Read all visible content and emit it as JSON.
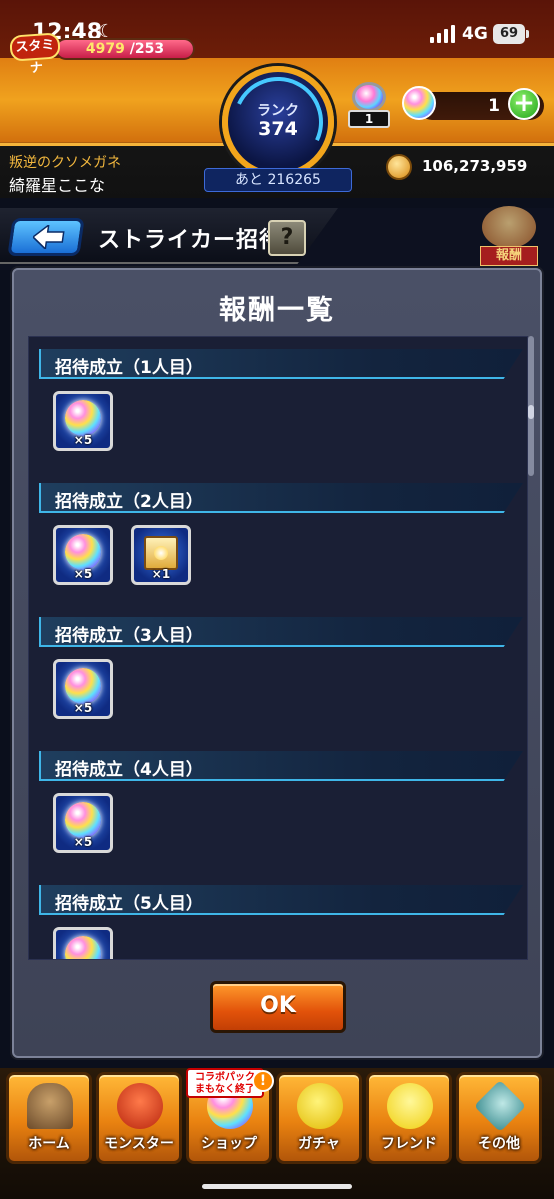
{
  "status_bar": {
    "time": "12:48",
    "network": "4G",
    "battery": "69"
  },
  "hud": {
    "stamina_label": "スタミナ",
    "stamina_current": "4979",
    "stamina_max": "/253",
    "rank_label": "ランク",
    "rank_value": "374",
    "next_rank": "あと 216265",
    "orb_pack_count": "1",
    "orb_count": "1",
    "player_subtitle": "叛逆のクソメガネ",
    "player_name": "綺羅星ここな",
    "coins": "106,273,959"
  },
  "header": {
    "title": "ストライカー招待",
    "help_label": "?",
    "reward_tag": "報酬"
  },
  "modal": {
    "title": "報酬一覧",
    "sections": [
      {
        "label": "招待成立（1人目）",
        "items": [
          {
            "type": "orb",
            "qty": "×5"
          }
        ]
      },
      {
        "label": "招待成立（2人目）",
        "items": [
          {
            "type": "orb",
            "qty": "×5"
          },
          {
            "type": "scroll",
            "qty": "×1"
          }
        ]
      },
      {
        "label": "招待成立（3人目）",
        "items": [
          {
            "type": "orb",
            "qty": "×5"
          }
        ]
      },
      {
        "label": "招待成立（4人目）",
        "items": [
          {
            "type": "orb",
            "qty": "×5"
          }
        ]
      },
      {
        "label": "招待成立（5人目）",
        "items": [
          {
            "type": "orb",
            "qty": ""
          }
        ]
      }
    ],
    "ok_label": "OK"
  },
  "bottom_nav": {
    "items": [
      {
        "label": "ホーム",
        "icon": "home-icon",
        "color": "#6b4a2a"
      },
      {
        "label": "モンスター",
        "icon": "monster-icon",
        "color": "#d8431c"
      },
      {
        "label": "ショップ",
        "icon": "orb-icon",
        "color": "#b76cff"
      },
      {
        "label": "ガチャ",
        "icon": "gacha-icon",
        "color": "#f0d312"
      },
      {
        "label": "フレンド",
        "icon": "friend-icon",
        "color": "#ffe04a"
      },
      {
        "label": "その他",
        "icon": "other-icon",
        "color": "#4aa3a6"
      }
    ],
    "shop_promo_line1": "コラボパック",
    "shop_promo_line2": "まもなく終了",
    "alert": "!"
  }
}
